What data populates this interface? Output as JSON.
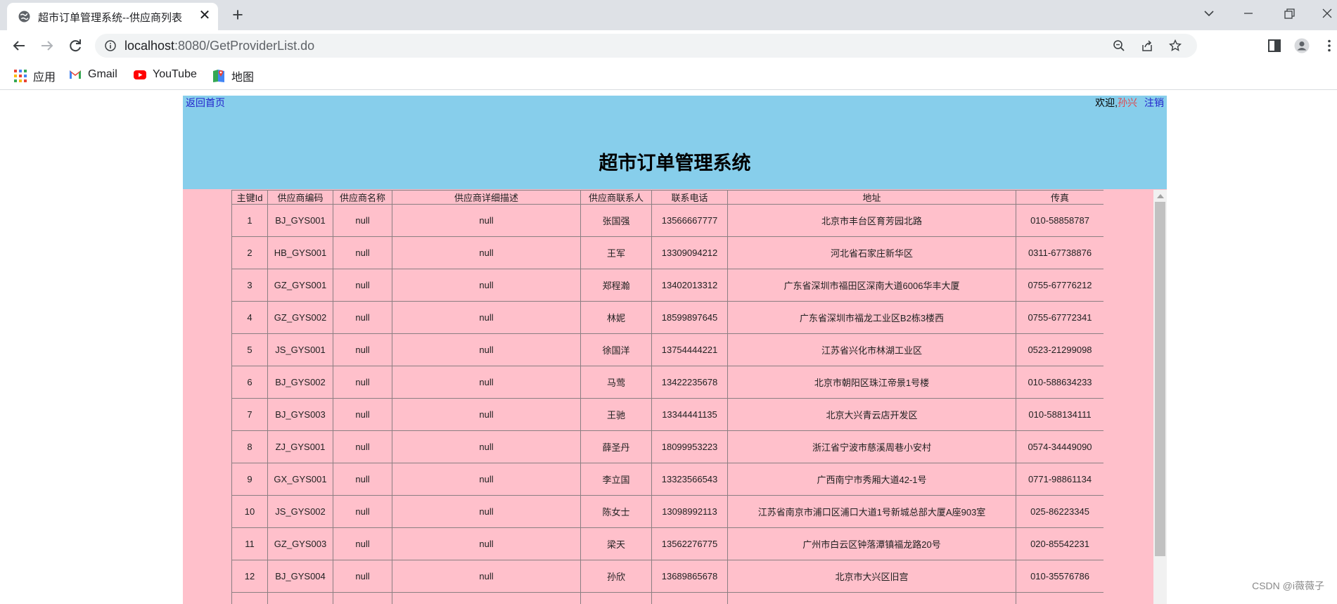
{
  "browser": {
    "tab_title": "超市订单管理系统--供应商列表",
    "tab_close": "✕",
    "new_tab": "+",
    "url_host": "localhost",
    "url_path": ":8080/GetProviderList.do",
    "bookmarks": [
      {
        "label": "应用",
        "icon": "apps-grid-icon"
      },
      {
        "label": "Gmail",
        "icon": "gmail-icon"
      },
      {
        "label": "YouTube",
        "icon": "youtube-icon"
      },
      {
        "label": "地图",
        "icon": "maps-icon"
      }
    ]
  },
  "page": {
    "home_link": "返回首页",
    "welcome_text": "欢迎,",
    "welcome_user": "孙兴",
    "logout": "注销",
    "title": "超市订单管理系统",
    "colors": {
      "header": "#87ceeb",
      "content": "#ffc0cb",
      "link": "#2222cc",
      "user": "#e0474c"
    }
  },
  "table": {
    "headers": [
      "主键Id",
      "供应商编码",
      "供应商名称",
      "供应商详细描述",
      "供应商联系人",
      "联系电话",
      "地址",
      "传真"
    ],
    "rows": [
      [
        "1",
        "BJ_GYS001",
        "null",
        "null",
        "张国强",
        "13566667777",
        "北京市丰台区育芳园北路",
        "010-58858787"
      ],
      [
        "2",
        "HB_GYS001",
        "null",
        "null",
        "王军",
        "13309094212",
        "河北省石家庄新华区",
        "0311-67738876"
      ],
      [
        "3",
        "GZ_GYS001",
        "null",
        "null",
        "郑程瀚",
        "13402013312",
        "广东省深圳市福田区深南大道6006华丰大厦",
        "0755-67776212"
      ],
      [
        "4",
        "GZ_GYS002",
        "null",
        "null",
        "林妮",
        "18599897645",
        "广东省深圳市福龙工业区B2栋3楼西",
        "0755-67772341"
      ],
      [
        "5",
        "JS_GYS001",
        "null",
        "null",
        "徐国洋",
        "13754444221",
        "江苏省兴化市林湖工业区",
        "0523-21299098"
      ],
      [
        "6",
        "BJ_GYS002",
        "null",
        "null",
        "马莺",
        "13422235678",
        "北京市朝阳区珠江帝景1号楼",
        "010-588634233"
      ],
      [
        "7",
        "BJ_GYS003",
        "null",
        "null",
        "王驰",
        "13344441135",
        "北京大兴青云店开发区",
        "010-588134111"
      ],
      [
        "8",
        "ZJ_GYS001",
        "null",
        "null",
        "薛圣丹",
        "18099953223",
        "浙江省宁波市慈溪周巷小安村",
        "0574-34449090"
      ],
      [
        "9",
        "GX_GYS001",
        "null",
        "null",
        "李立国",
        "13323566543",
        "广西南宁市秀厢大道42-1号",
        "0771-98861134"
      ],
      [
        "10",
        "JS_GYS002",
        "null",
        "null",
        "陈女士",
        "13098992113",
        "江苏省南京市浦口区浦口大道1号新城总部大厦A座903室",
        "025-86223345"
      ],
      [
        "11",
        "GZ_GYS003",
        "null",
        "null",
        "梁天",
        "13562276775",
        "广州市白云区钟落潭镇福龙路20号",
        "020-85542231"
      ],
      [
        "12",
        "BJ_GYS004",
        "null",
        "null",
        "孙欣",
        "13689865678",
        "北京市大兴区旧宫",
        "010-35576786"
      ],
      [
        "",
        "",
        "",
        "",
        "",
        "",
        "",
        ""
      ]
    ]
  },
  "watermark": "CSDN @i薇薇子"
}
